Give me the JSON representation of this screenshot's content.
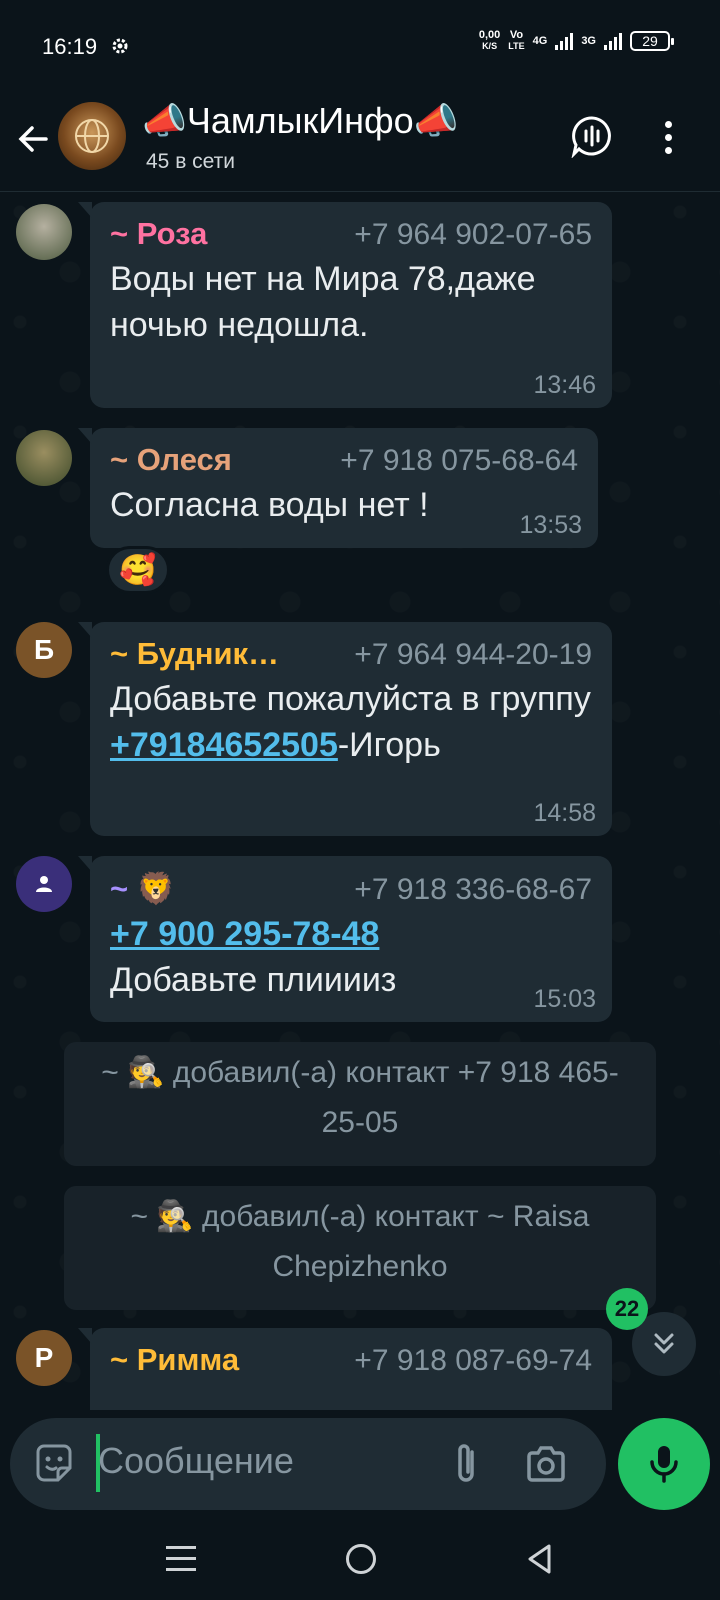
{
  "status_bar": {
    "time": "16:19",
    "net_speed_value": "0,00",
    "net_speed_unit": "K/S",
    "volte_top": "Vo",
    "volte_bottom": "LTE",
    "net1": "4G",
    "net2": "3G",
    "battery": "29"
  },
  "header": {
    "title": "📣ЧамлыкИнфо📣",
    "subtitle": "45 в сети"
  },
  "messages": [
    {
      "sender": "~ Роза",
      "sender_color": "#ff72a1",
      "phone": "+7 964 902-07-65",
      "text": "Воды нет на Мира 78,даже ночью недошла.",
      "time": "13:46"
    },
    {
      "sender": "~ Олеся",
      "sender_color": "#e6a27a",
      "phone": "+7 918 075-68-64",
      "text": "Согласна воды нет !",
      "time": "13:53",
      "reaction": "🥰"
    },
    {
      "sender": "~ Будник…",
      "sender_color": "#ffbc38",
      "phone": "+7 964 944-20-19",
      "avatar_letter": "Б",
      "avatar_color": "#7a5328",
      "text_before": "Добавьте пожалуйста в группу",
      "link": "+79184652505",
      "text_after": "-Игорь",
      "time": "14:58"
    },
    {
      "sender": "~ 🦁",
      "sender_color": "#a791ff",
      "phone": "+7 918 336-68-67",
      "avatar_color": "#3a2f7a",
      "link": "+7 900 295-78-48",
      "text": "Добавьте плииииз",
      "time": "15:03"
    },
    {
      "sender": "~ Римма",
      "sender_color": "#ffbc38",
      "phone": "+7 918 087-69-74",
      "avatar_letter": "Р",
      "avatar_color": "#7a5328"
    }
  ],
  "system_messages": [
    "~ 🕵️ добавил(-а) контакт +7 918 465-25-05",
    "~ 🕵️ добавил(-а) контакт ~ Raisa Chepizhenko"
  ],
  "unread_count": "22",
  "composer": {
    "placeholder": "Сообщение"
  },
  "colors": {
    "accent": "#21c063",
    "bubble": "#1f2c34",
    "background": "#0b141a",
    "link": "#53bdeb"
  },
  "icons": [
    "back-arrow-icon",
    "voice-chat-icon",
    "more-icon",
    "sticker-icon",
    "attach-icon",
    "camera-icon",
    "mic-icon",
    "chevron-down-double-icon"
  ]
}
